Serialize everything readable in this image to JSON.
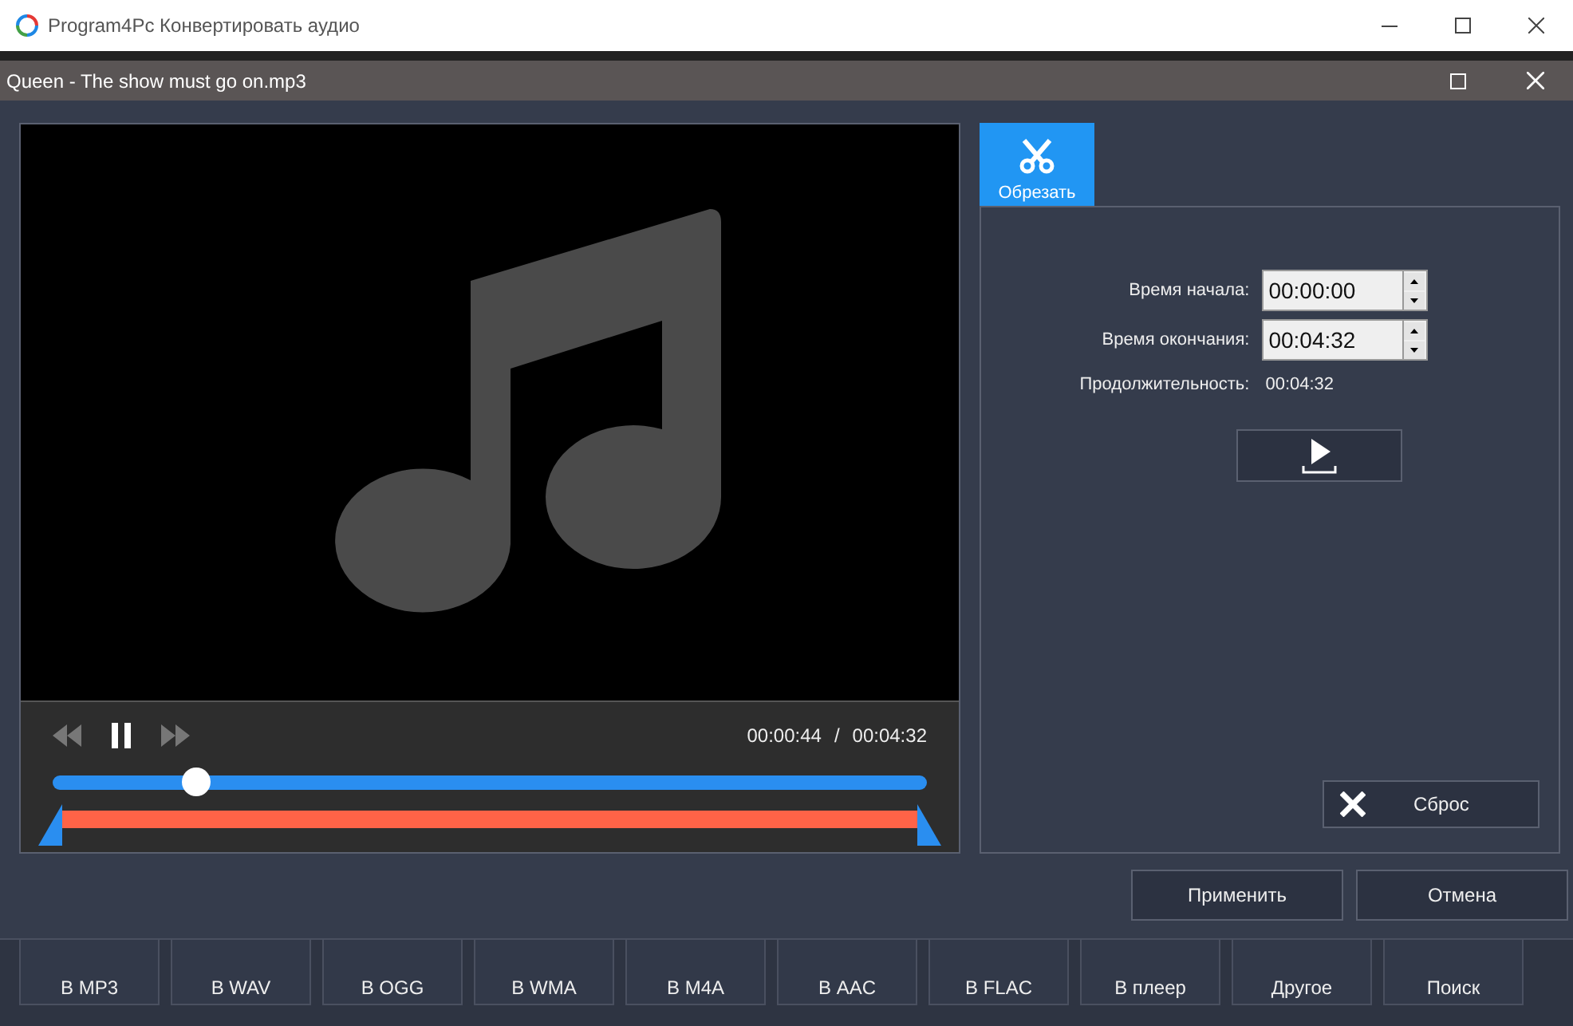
{
  "app": {
    "title": "Program4Pc Конвертировать аудио"
  },
  "dialog": {
    "title": "Queen - The show must go on.mp3"
  },
  "player": {
    "playing": true,
    "current": "00:00:44",
    "separator": "/",
    "total": "00:04:32",
    "level": 0.165
  },
  "tabs": [
    {
      "label": "Обрезать",
      "selected": true
    }
  ],
  "trim": {
    "fields": [
      {
        "label": "Время начала:",
        "value": "00:00:00",
        "kind": "spin"
      },
      {
        "label": "Время окончания:",
        "value": "00:04:32",
        "kind": "spin"
      },
      {
        "label": "Продолжительность:",
        "value": "00:04:32",
        "kind": "text"
      }
    ],
    "reset": "Сброс"
  },
  "buttons": [
    "Применить",
    "Отмена"
  ],
  "formats": [
    "В MP3",
    "В WAV",
    "В OGG",
    "В WMA",
    "В M4A",
    "В AAC",
    "В FLAC",
    "В плеер",
    "Другое",
    "Поиск"
  ]
}
